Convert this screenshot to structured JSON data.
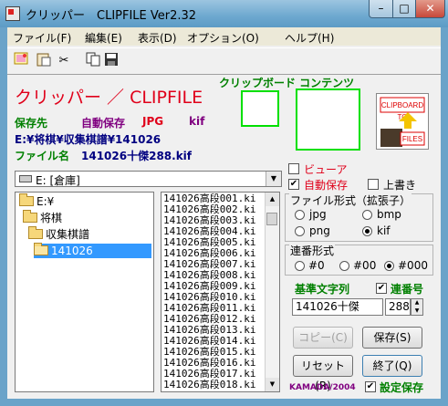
{
  "window": {
    "title": "クリッパー　CLIPFILE Ver2.32",
    "min": "–",
    "max": "□",
    "close": "✕"
  },
  "menu": [
    {
      "label": "ファイル(F)"
    },
    {
      "label": "編集(E)"
    },
    {
      "label": "表示(D)"
    },
    {
      "label": "オプション(O)"
    },
    {
      "label": "ヘルプ(H)"
    }
  ],
  "toolbar": {
    "icons": [
      "pictures-icon",
      "paste-icon",
      "cut-icon",
      "copy-icon",
      "save-icon"
    ]
  },
  "header": {
    "app_name": "クリッパー ／ CLIPFILE",
    "clipboard_label": "クリップボード コンテンツ",
    "save_dest_label": "保存先",
    "auto_save_label": "自動保存",
    "format_jpg": "JPG",
    "format_kif": "kif",
    "save_path": "E:¥将棋¥収集棋譜¥141026",
    "filename_label": "ファイル名",
    "filename_value": "141026十傑288.kif",
    "logo_text_top": "CLIPBOARD",
    "logo_text_mid": "TO",
    "logo_text_bot": "FILES"
  },
  "drive": {
    "value": "E: [倉庫]"
  },
  "tree": {
    "nodes": [
      {
        "label": "E:¥"
      },
      {
        "label": "将棋"
      },
      {
        "label": "収集棋譜"
      },
      {
        "label": "141026"
      }
    ]
  },
  "files": [
    "141026高段001.ki",
    "141026高段002.ki",
    "141026高段003.ki",
    "141026高段004.ki",
    "141026高段005.ki",
    "141026高段006.ki",
    "141026高段007.ki",
    "141026高段008.ki",
    "141026高段009.ki",
    "141026高段010.ki",
    "141026高段011.ki",
    "141026高段012.ki",
    "141026高段013.ki",
    "141026高段014.ki",
    "141026高段015.ki",
    "141026高段016.ki",
    "141026高段017.ki",
    "141026高段018.ki"
  ],
  "options": {
    "viewer_label": "ビューア",
    "viewer_checked": false,
    "autosave_label": "自動保存",
    "autosave_checked": true,
    "overwrite_label": "上書き",
    "overwrite_checked": false
  },
  "file_format": {
    "title": "ファイル形式（拡張子）",
    "options": [
      {
        "label": "jpg",
        "selected": false
      },
      {
        "label": "bmp",
        "selected": false
      },
      {
        "label": "png",
        "selected": false
      },
      {
        "label": "kif",
        "selected": true
      }
    ]
  },
  "serial_format": {
    "title": "連番形式",
    "options": [
      {
        "label": "#0",
        "selected": false
      },
      {
        "label": "#00",
        "selected": false
      },
      {
        "label": "#000",
        "selected": true
      }
    ]
  },
  "base_string": {
    "label": "基準文字列",
    "serial_label": "連番号",
    "serial_checked": true,
    "value": "141026十傑",
    "number": "288"
  },
  "buttons": {
    "copy": "コピー(C)",
    "save": "保存(S)",
    "reset": "リセット(R)",
    "exit": "終了(Q)"
  },
  "footer": {
    "author": "KAMADA/2004",
    "save_settings_label": "設定保存",
    "save_settings_checked": true
  },
  "colors": {
    "accent_red": "#e0001a",
    "accent_green": "#008000",
    "selection": "#3399ff",
    "clip_border": "#00e000"
  }
}
